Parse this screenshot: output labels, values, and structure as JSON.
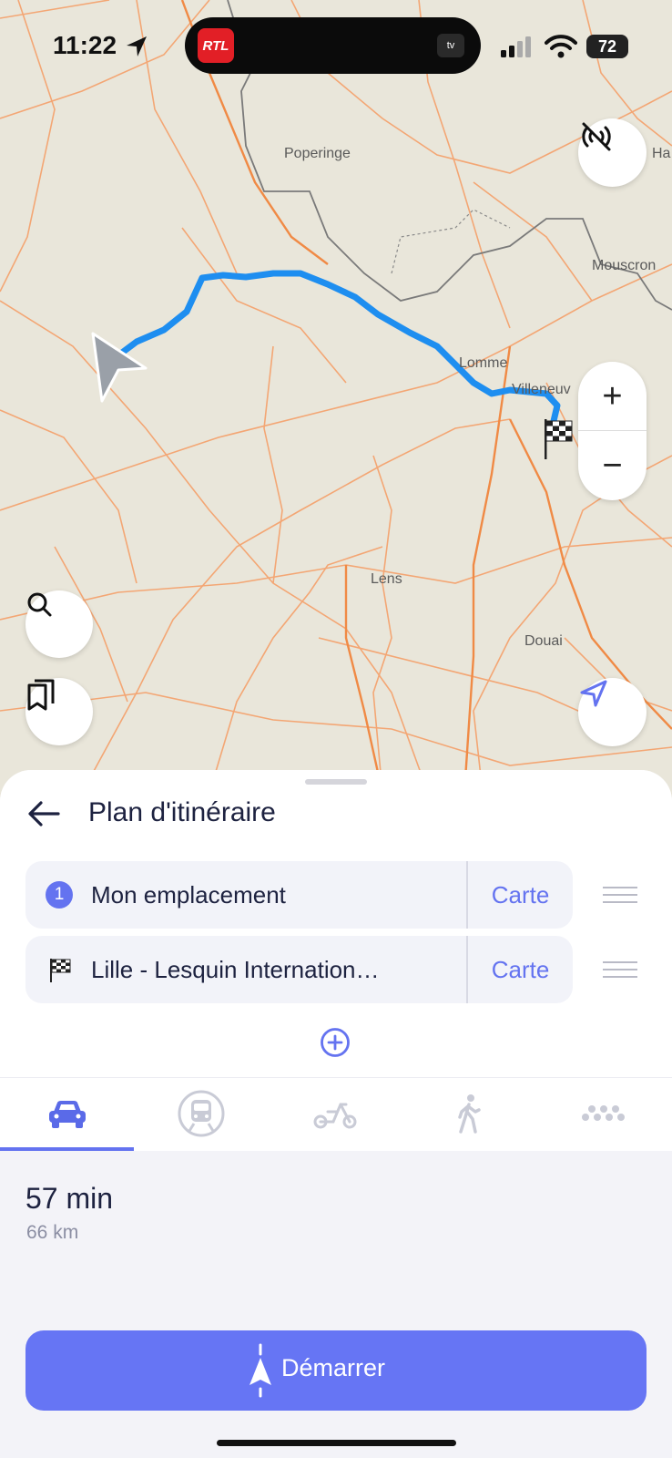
{
  "status_bar": {
    "time": "11:22",
    "battery": "72",
    "live_app": "RTL",
    "tv_label": "tv"
  },
  "map": {
    "places": [
      "Poperinge",
      "Mouscron",
      "Lomme",
      "Villeneuv",
      "Lens",
      "Douai",
      "Ha"
    ],
    "route_color": "#1e8ef0"
  },
  "sheet": {
    "title": "Plan d'itinéraire",
    "stops": [
      {
        "index": "1",
        "label": "Mon emplacement",
        "action": "Carte"
      },
      {
        "label": "Lille - Lesquin International Air...",
        "action": "Carte"
      }
    ]
  },
  "modes": [
    {
      "name": "car",
      "active": true
    },
    {
      "name": "train",
      "active": false
    },
    {
      "name": "bike",
      "active": false
    },
    {
      "name": "walk",
      "active": false
    },
    {
      "name": "more",
      "active": false
    }
  ],
  "summary": {
    "duration": "57 min",
    "distance": "66 km"
  },
  "start_button": {
    "label": "Démarrer"
  },
  "colors": {
    "accent": "#6675f4",
    "road": "#f28c4a",
    "border": "#7a7a7a"
  }
}
